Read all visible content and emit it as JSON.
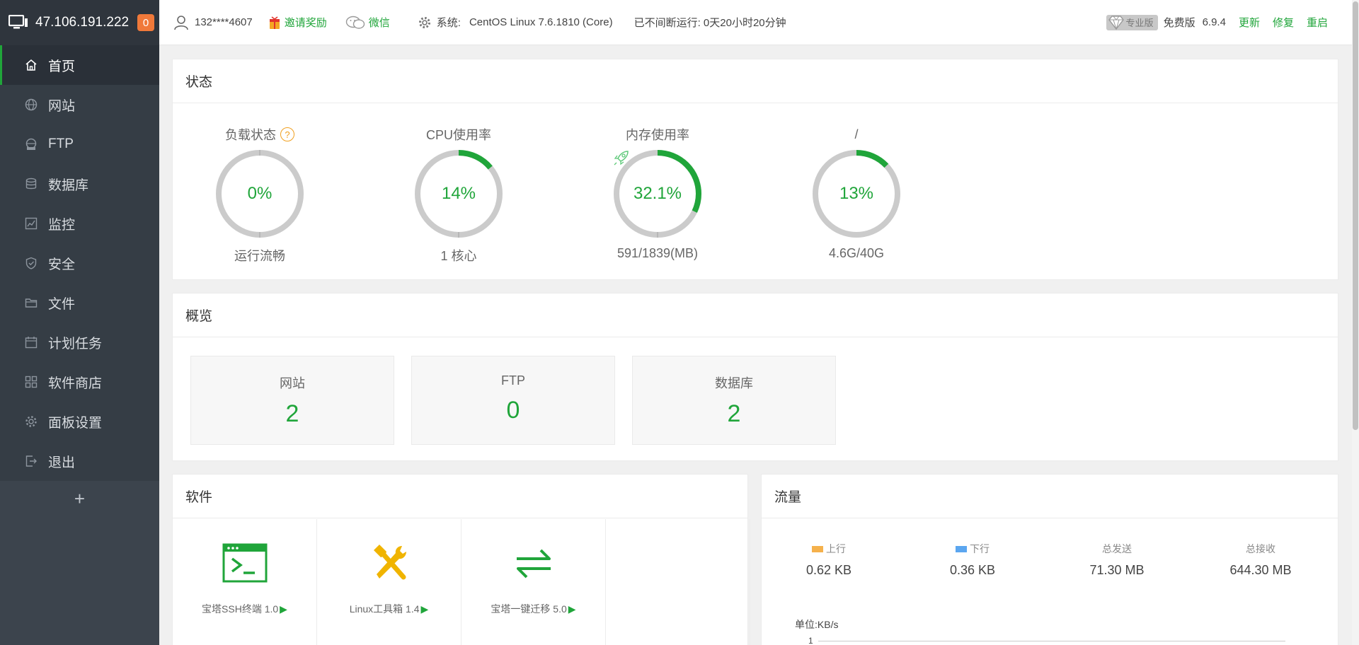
{
  "sidebar": {
    "ip": "47.106.191.222",
    "badge": "0",
    "items": [
      {
        "label": "首页",
        "icon": "home-icon"
      },
      {
        "label": "网站",
        "icon": "globe-icon"
      },
      {
        "label": "FTP",
        "icon": "ftp-icon"
      },
      {
        "label": "数据库",
        "icon": "database-icon"
      },
      {
        "label": "监控",
        "icon": "monitor-chart-icon"
      },
      {
        "label": "安全",
        "icon": "shield-icon"
      },
      {
        "label": "文件",
        "icon": "folder-icon"
      },
      {
        "label": "计划任务",
        "icon": "calendar-icon"
      },
      {
        "label": "软件商店",
        "icon": "grid-icon"
      },
      {
        "label": "面板设置",
        "icon": "gear-icon"
      },
      {
        "label": "退出",
        "icon": "logout-icon"
      }
    ],
    "add": "+"
  },
  "topbar": {
    "user": "132****4607",
    "invite": "邀请奖励",
    "wechat": "微信",
    "system_label": "系统:",
    "system_value": "CentOS Linux 7.6.1810 (Core)",
    "uptime": "已不间断运行: 0天20小时20分钟",
    "pro": "专业版",
    "free": "免费版",
    "version": "6.9.4",
    "update": "更新",
    "repair": "修复",
    "restart": "重启"
  },
  "status": {
    "title": "状态",
    "gauges": [
      {
        "title": "负载状态",
        "value": "0%",
        "sub": "运行流畅",
        "pct": 0,
        "help": "?"
      },
      {
        "title": "CPU使用率",
        "value": "14%",
        "sub": "1 核心",
        "pct": 14
      },
      {
        "title": "内存使用率",
        "value": "32.1%",
        "sub": "591/1839(MB)",
        "pct": 32.1
      },
      {
        "title": "/",
        "value": "13%",
        "sub": "4.6G/40G",
        "pct": 13
      }
    ]
  },
  "overview": {
    "title": "概览",
    "boxes": [
      {
        "label": "网站",
        "value": "2"
      },
      {
        "label": "FTP",
        "value": "0"
      },
      {
        "label": "数据库",
        "value": "2"
      }
    ]
  },
  "software": {
    "title": "软件",
    "items": [
      {
        "name": "宝塔SSH终端 1.0",
        "icon": "terminal-icon"
      },
      {
        "name": "Linux工具箱 1.4",
        "icon": "tools-icon"
      },
      {
        "name": "宝塔一键迁移 5.0",
        "icon": "transfer-icon"
      }
    ],
    "play": "▶"
  },
  "traffic": {
    "title": "流量",
    "up_label": "上行",
    "down_label": "下行",
    "sent_label": "总发送",
    "recv_label": "总接收",
    "up": "0.62 KB",
    "down": "0.36 KB",
    "sent": "71.30 MB",
    "recv": "644.30 MB",
    "unit": "单位:KB/s",
    "axis_top": "1",
    "colors": {
      "up": "#f5b14c",
      "down": "#5ba6f0"
    }
  },
  "colors": {
    "accent": "#20a53a",
    "sidebar": "#3c444d",
    "badge": "#f0793a"
  }
}
